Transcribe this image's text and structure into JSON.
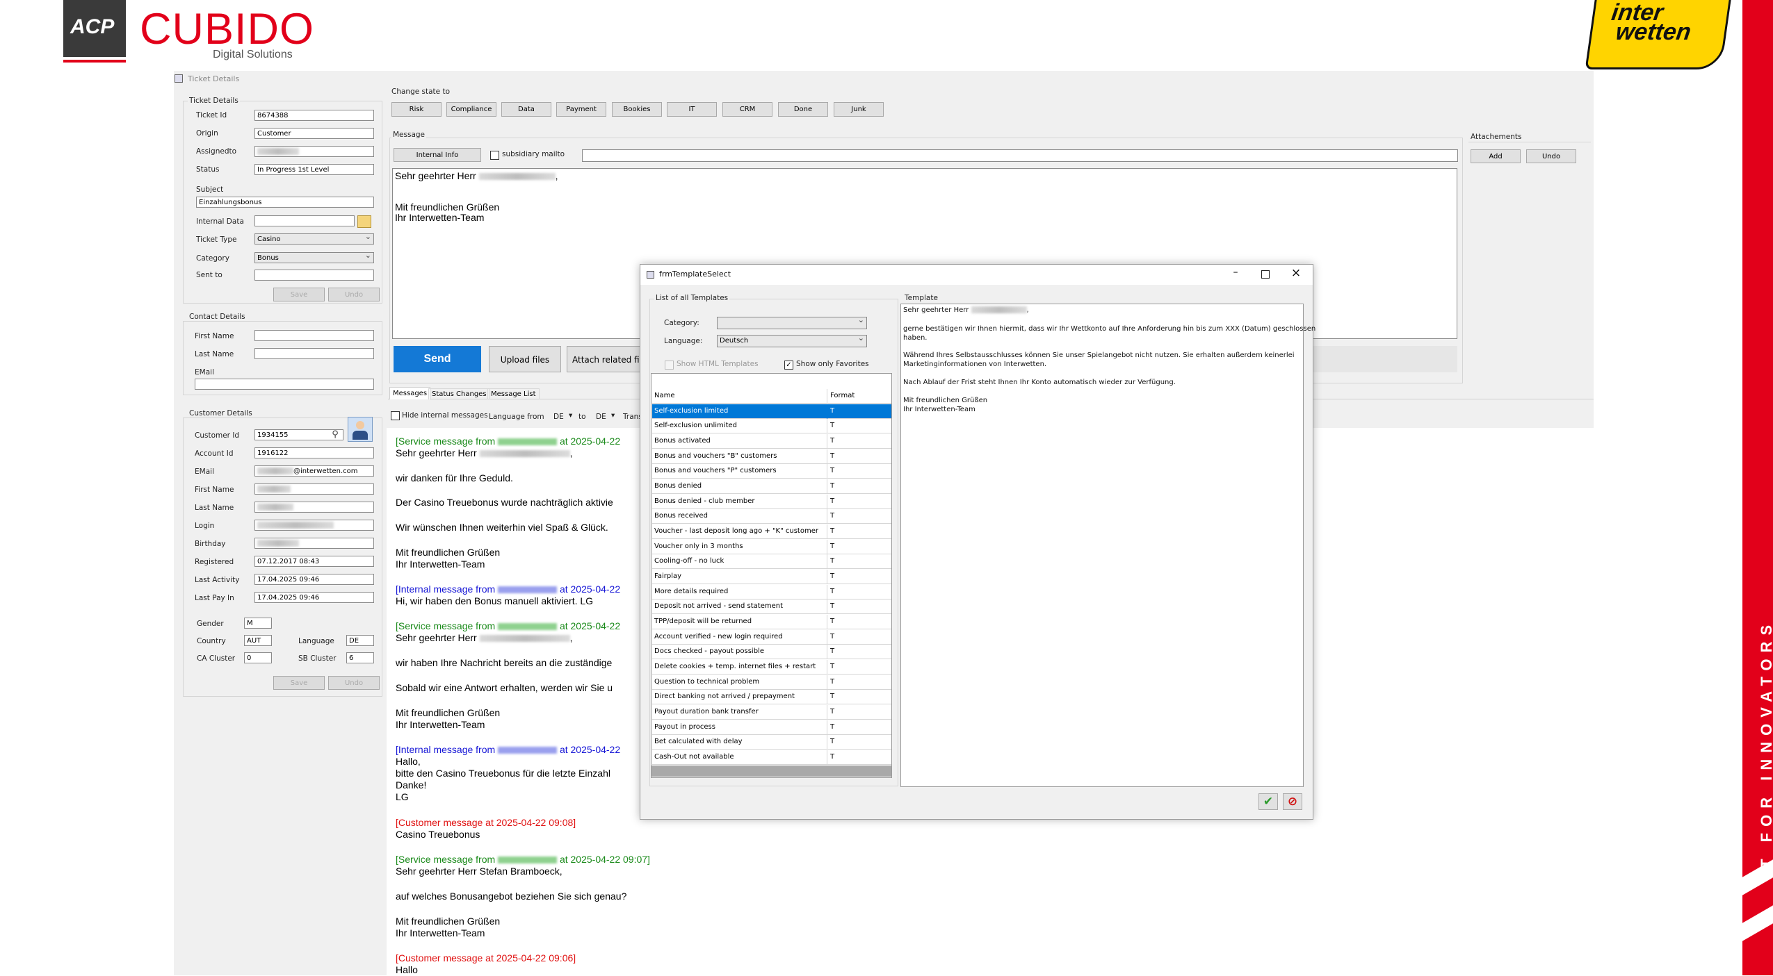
{
  "brand": {
    "acp": "ACP",
    "cubido": "CUBIDO",
    "tagline": "Digital Solutions",
    "partner_line1": "inter",
    "partner_line2": "wetten",
    "slogan": "IT FOR INNOVATORS"
  },
  "window": {
    "title": "Ticket Details"
  },
  "ticket": {
    "group": "Ticket Details",
    "ticket_id_label": "Ticket Id",
    "ticket_id": "8674388",
    "origin_label": "Origin",
    "origin": "Customer",
    "assigned_label": "Assignedto",
    "status_label": "Status",
    "status": "In Progress 1st Level",
    "subject_label": "Subject",
    "subject": "Einzahlungsbonus",
    "internal_label": "Internal Data",
    "type_label": "Ticket Type",
    "type": "Casino",
    "category_label": "Category",
    "category": "Bonus",
    "sent_label": "Sent to",
    "save": "Save",
    "undo": "Undo"
  },
  "contact": {
    "group": "Contact Details",
    "first_label": "First Name",
    "last_label": "Last Name",
    "email_label": "EMail"
  },
  "customer": {
    "group": "Customer Details",
    "customer_id_label": "Customer Id",
    "customer_id": "1934155",
    "account_label": "Account Id",
    "account": "1916122",
    "email_label": "EMail",
    "email": "@interwetten.com",
    "first_label": "First Name",
    "last_label": "Last Name",
    "login_label": "Login",
    "birthday_label": "Birthday",
    "registered_label": "Registered",
    "registered": "07.12.2017 08:43",
    "last_activity_label": "Last Activity",
    "last_activity": "17.04.2025 09:46",
    "last_pay_label": "Last Pay In",
    "last_pay": "17.04.2025 09:46",
    "gender_label": "Gender",
    "gender": "M",
    "country_label": "Country",
    "country": "AUT",
    "language_label": "Language",
    "language": "DE",
    "ca_label": "CA Cluster",
    "ca": "0",
    "sb_label": "SB Cluster",
    "sb": "6",
    "save": "Save",
    "undo": "Undo"
  },
  "state": {
    "label": "Change state to",
    "buttons": [
      "Risk",
      "Compliance",
      "Data",
      "Payment",
      "Bookies",
      "IT",
      "CRM",
      "Done",
      "Junk"
    ]
  },
  "message": {
    "group": "Message",
    "internal_info": "Internal Info",
    "subsidiary": "subsidiary mailto",
    "greeting": "Sehr geehrter Herr",
    "closing1": "Mit freundlichen Grüßen",
    "closing2": "Ihr Interwetten-Team",
    "send": "Send",
    "upload": "Upload files",
    "attach": "Attach related files"
  },
  "attachments": {
    "group": "Attachements",
    "add": "Add",
    "undo": "Undo"
  },
  "tabs": {
    "messages": "Messages",
    "status": "Status Changes",
    "list": "Message List"
  },
  "filter": {
    "hide_internal": "Hide internal messages",
    "lang_from": "Language from",
    "from": "DE",
    "to_label": "to",
    "to": "DE",
    "trans": "Trans"
  },
  "history": {
    "l1": "[Service message from",
    "l1b": "at 2025-04-22",
    "l2": "Sehr geehrter Herr",
    "l3": "wir danken für Ihre Geduld.",
    "l4": "Der Casino Treuebonus wurde nachträglich aktivie",
    "l5": "Wir wünschen Ihnen weiterhin viel Spaß & Glück.",
    "l6": "Mit freundlichen Grüßen",
    "l7": "Ihr Interwetten-Team",
    "l8": "[Internal message from",
    "l8b": "at 2025-04-22",
    "l9": "Hi, wir haben den Bonus manuell aktiviert. LG",
    "l10": "[Service message from",
    "l10b": "at 2025-04-22",
    "l11": "Sehr geehrter Herr",
    "l12": "wir haben Ihre Nachricht bereits an die zuständige",
    "l13": "Sobald wir eine Antwort erhalten, werden wir Sie u",
    "l14": "Mit freundlichen Grüßen",
    "l15": "Ihr Interwetten-Team",
    "l16": "[Internal message from",
    "l16b": "at 2025-04-22",
    "l17": "Hallo,",
    "l18": "bitte den Casino Treuebonus für die letzte Einzahl",
    "l19": "Danke!",
    "l20": "LG",
    "l21": "[Customer message at 2025-04-22 09:08]",
    "l22": "Casino Treuebonus",
    "l23": "[Service message from",
    "l23b": "at 2025-04-22 09:07]",
    "l24": "Sehr geehrter Herr Stefan Bramboeck,",
    "l25": "auf welches Bonusangebot beziehen Sie sich genau?",
    "l26": "Mit freundlichen Grüßen",
    "l27": "Ihr Interwetten-Team",
    "l28": "[Customer message at 2025-04-22 09:06]",
    "l29": "Hallo"
  },
  "dialog": {
    "title": "frmTemplateSelect",
    "list_group": "List of all Templates",
    "category_label": "Category:",
    "language_label": "Language:",
    "language": "Deutsch",
    "html_label": "Show HTML Templates",
    "fav_label": "Show only Favorites",
    "col_name": "Name",
    "col_format": "Format",
    "rows": [
      {
        "name": "Self-exclusion limited",
        "format": "T"
      },
      {
        "name": "Self-exclusion unlimited",
        "format": "T"
      },
      {
        "name": "Bonus activated",
        "format": "T"
      },
      {
        "name": "Bonus and vouchers \"B\" customers",
        "format": "T"
      },
      {
        "name": "Bonus and vouchers \"P\" customers",
        "format": "T"
      },
      {
        "name": "Bonus denied",
        "format": "T"
      },
      {
        "name": "Bonus denied - club member",
        "format": "T"
      },
      {
        "name": "Bonus received",
        "format": "T"
      },
      {
        "name": "Voucher - last deposit long ago + \"K\" customer",
        "format": "T"
      },
      {
        "name": "Voucher only in 3 months",
        "format": "T"
      },
      {
        "name": "Cooling-off - no luck",
        "format": "T"
      },
      {
        "name": "Fairplay",
        "format": "T"
      },
      {
        "name": "More details required",
        "format": "T"
      },
      {
        "name": "Deposit not arrived - send statement",
        "format": "T"
      },
      {
        "name": "TPP/deposit will be returned",
        "format": "T"
      },
      {
        "name": "Account verified - new login required",
        "format": "T"
      },
      {
        "name": "Docs checked - payout possible",
        "format": "T"
      },
      {
        "name": "Delete cookies + temp. internet files + restart",
        "format": "T"
      },
      {
        "name": "Question to technical problem",
        "format": "T"
      },
      {
        "name": "Direct banking not arrived / prepayment",
        "format": "T"
      },
      {
        "name": "Payout duration bank transfer",
        "format": "T"
      },
      {
        "name": "Payout in process",
        "format": "T"
      },
      {
        "name": "Bet calculated with delay",
        "format": "T"
      },
      {
        "name": "Cash-Out not available",
        "format": "T"
      }
    ],
    "template_group": "Template",
    "template": {
      "t1": "Sehr geehrter Herr",
      "t2": "gerne bestätigen wir Ihnen hiermit, dass wir Ihr Wettkonto auf Ihre Anforderung hin bis zum XXX (Datum) geschlossen",
      "t3": "haben.",
      "t4": "Während Ihres Selbstausschlusses können Sie unser Spielangebot nicht nutzen. Sie erhalten außerdem keinerlei",
      "t5": "Marketinginformationen von Interwetten.",
      "t6": "Nach Ablauf der Frist steht Ihnen Ihr Konto automatisch wieder zur Verfügung.",
      "t7": "Mit freundlichen Grüßen",
      "t8": "Ihr Interwetten-Team"
    }
  }
}
